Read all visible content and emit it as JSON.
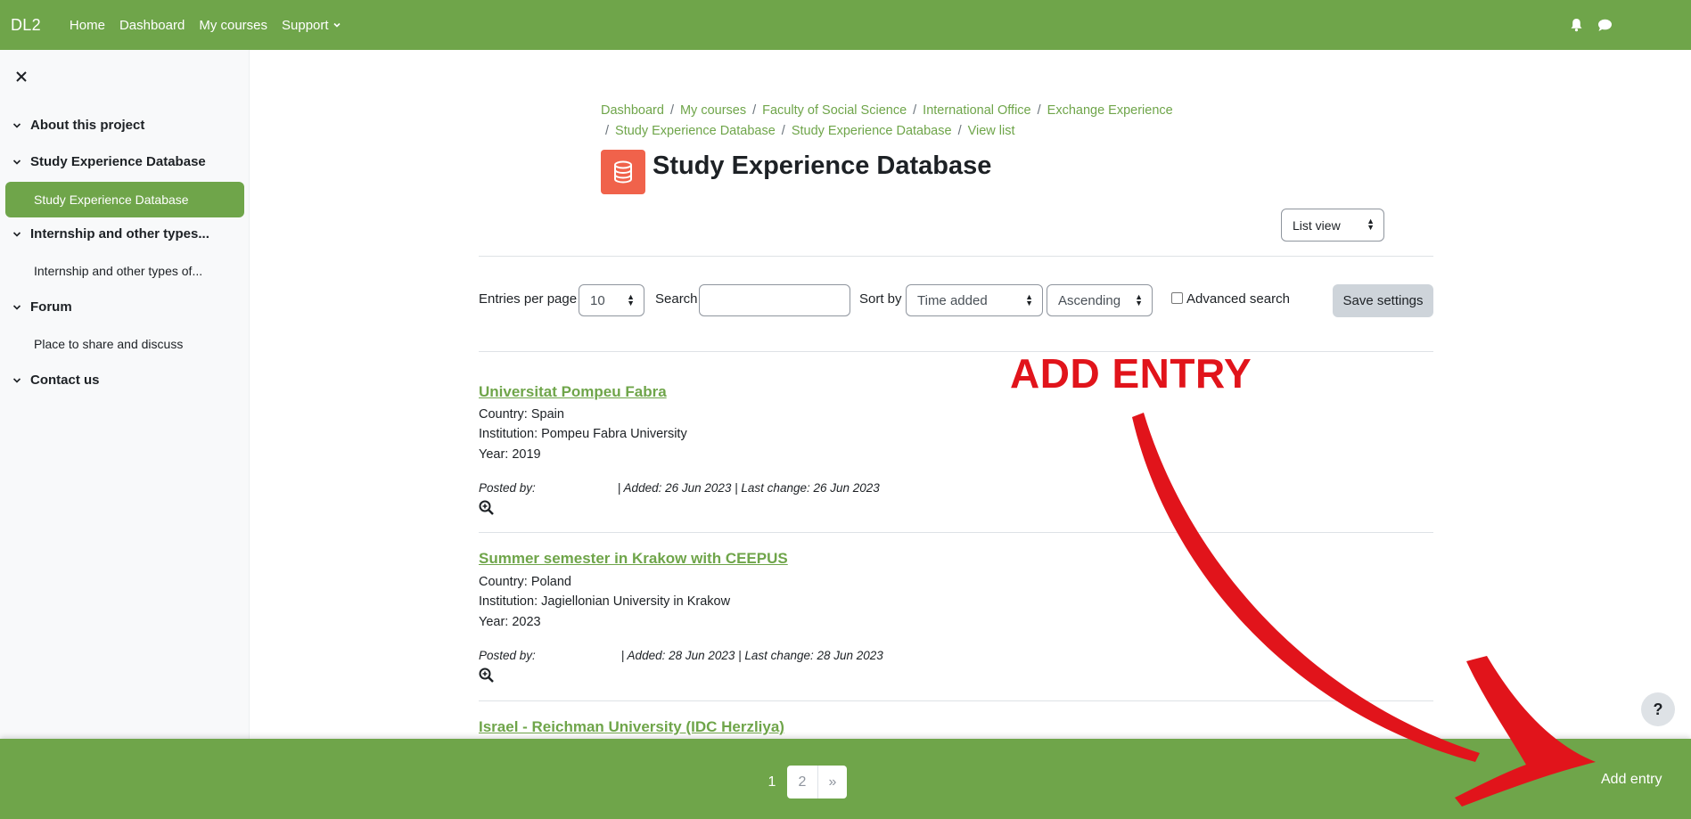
{
  "navbar": {
    "brand": "DL2",
    "links": [
      "Home",
      "Dashboard",
      "My courses",
      "Support"
    ],
    "icons": [
      "bell-icon",
      "chat-icon"
    ]
  },
  "sidebar": {
    "close_icon": "close-icon",
    "sections": [
      {
        "label": "About this project"
      },
      {
        "label": "Study Experience Database",
        "items": [
          "Study Experience Database"
        ]
      },
      {
        "label": "Internship and other types...",
        "items": [
          "Internship and other types of..."
        ]
      },
      {
        "label": "Forum",
        "items": [
          "Place to share and discuss"
        ]
      },
      {
        "label": "Contact us"
      }
    ]
  },
  "breadcrumb": [
    "Dashboard",
    "My courses",
    "Faculty of Social Science",
    "International Office",
    "Exchange Experience",
    "Study Experience Database",
    "Study Experience Database",
    "View list"
  ],
  "page": {
    "title": "Study Experience Database",
    "view_select": "List view"
  },
  "controls": {
    "entries_label": "Entries per page",
    "entries_value": "10",
    "search_label": "Search",
    "search_value": "",
    "sortby_label": "Sort by",
    "sortby_value": "Time added",
    "order_value": "Ascending",
    "advanced_label": "Advanced search",
    "save_label": "Save settings"
  },
  "entries": [
    {
      "title": "Universitat Pompeu Fabra",
      "country": "Country: Spain",
      "institution": "Institution: Pompeu Fabra University",
      "year": "Year: 2019",
      "posted_by": "Posted by:",
      "meta": "| Added: 26 Jun 2023 | Last change: 26 Jun 2023"
    },
    {
      "title": "Summer semester in Krakow with CEEPUS",
      "country": "Country: Poland",
      "institution": "Institution: Jagiellonian University in Krakow",
      "year": "Year: 2023",
      "posted_by": "Posted by:",
      "meta": "| Added: 28 Jun 2023 | Last change: 28 Jun 2023"
    },
    {
      "title": "Israel - Reichman University (IDC Herzliya)"
    }
  ],
  "annotation": {
    "text": "ADD ENTRY",
    "color": "#e1141b"
  },
  "help": "?",
  "pagination": [
    "1",
    "2",
    "»"
  ],
  "footer": {
    "add_entry_label": "Add entry"
  },
  "colors": {
    "brand": "#6fa54a",
    "title_icon": "#f0624b"
  }
}
